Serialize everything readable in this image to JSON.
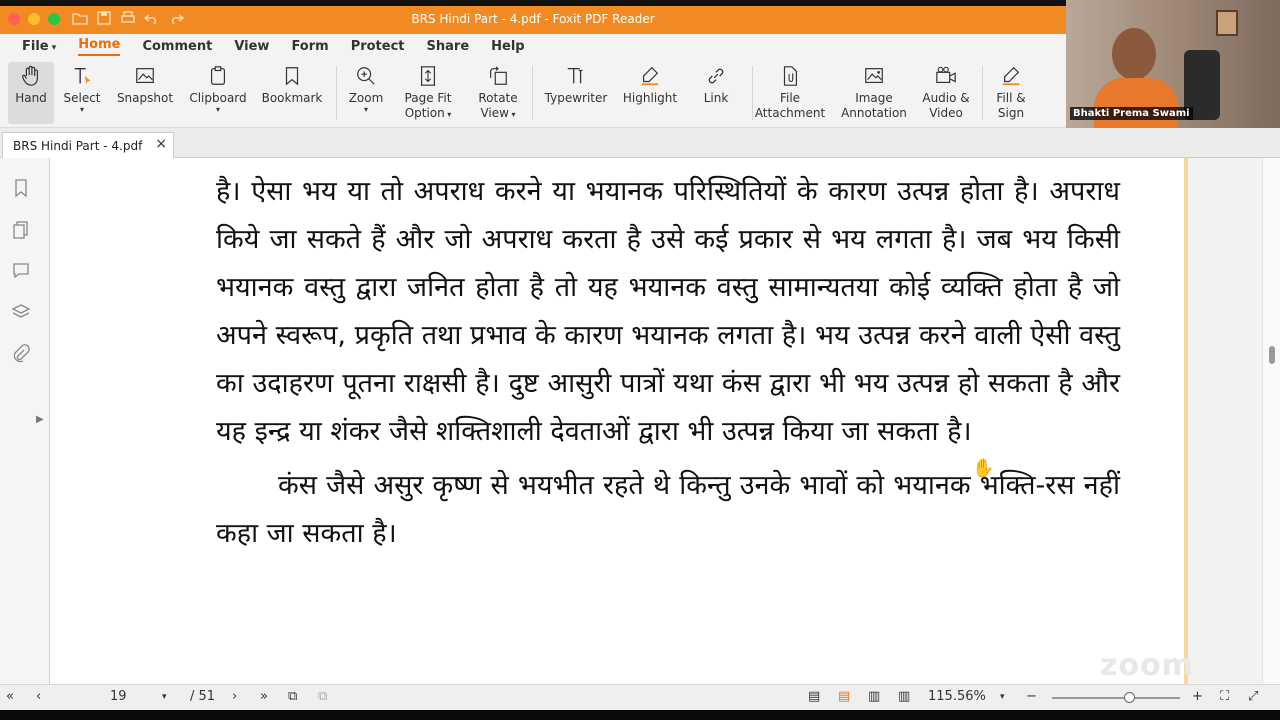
{
  "window": {
    "title": "BRS Hindi Part - 4.pdf - Foxit PDF Reader"
  },
  "colors": {
    "accent": "#f28a24",
    "active_tab": "#e86f0f"
  },
  "menu": {
    "items": [
      {
        "label": "File"
      },
      {
        "label": "Home",
        "active": true
      },
      {
        "label": "Comment"
      },
      {
        "label": "View"
      },
      {
        "label": "Form"
      },
      {
        "label": "Protect"
      },
      {
        "label": "Share"
      },
      {
        "label": "Help"
      }
    ]
  },
  "ribbon": {
    "hand": "Hand",
    "select": "Select",
    "snapshot": "Snapshot",
    "clipboard": "Clipboard",
    "bookmark": "Bookmark",
    "zoom": "Zoom",
    "pagefit_1": "Page Fit",
    "pagefit_2": "Option",
    "rotate_1": "Rotate",
    "rotate_2": "View",
    "typewriter": "Typewriter",
    "highlight": "Highlight",
    "link": "Link",
    "file_attach_1": "File",
    "file_attach_2": "Attachment",
    "image_annot_1": "Image",
    "image_annot_2": "Annotation",
    "audio_video_1": "Audio &",
    "audio_video_2": "Video",
    "fill_sign_1": "Fill &",
    "fill_sign_2": "Sign"
  },
  "tab": {
    "label": "BRS Hindi Part - 4.pdf",
    "close": "×"
  },
  "document": {
    "paragraph1": "है। ऐसा भय या तो अपराध करने या भयानक परिस्थितियों के कारण उत्पन्न होता है। अपराध किये जा सकते हैं और जो अपराध करता है उसे कई प्रकार से भय लगता है। जब भय किसी भयानक वस्तु द्वारा जनित होता है तो यह भयानक वस्तु सामान्यतया कोई व्यक्ति होता है जो अपने स्वरूप, प्रकृति तथा प्रभाव के कारण भयानक लगता है। भय उत्पन्न करने वाली ऐसी वस्तु का उदाहरण पूतना राक्षसी है। दुष्ट आसुरी पात्रों यथा कंस द्वारा भी भय उत्पन्न हो सकता है और यह इन्द्र या शंकर जैसे शक्तिशाली देवताओं द्वारा भी उत्पन्न किया जा सकता है।",
    "paragraph2": "कंस जैसे असुर कृष्ण से भयभीत रहते थे किन्तु उनके भावों को भयानक भक्ति-रस नहीं कहा जा सकता है।"
  },
  "status": {
    "current_page": "19",
    "total_pages": "/ 51",
    "zoom": "115.56%",
    "zoom_level": 0.6
  },
  "webcam": {
    "name": "Bhakti Prema Swami",
    "watermark": "zoom"
  }
}
